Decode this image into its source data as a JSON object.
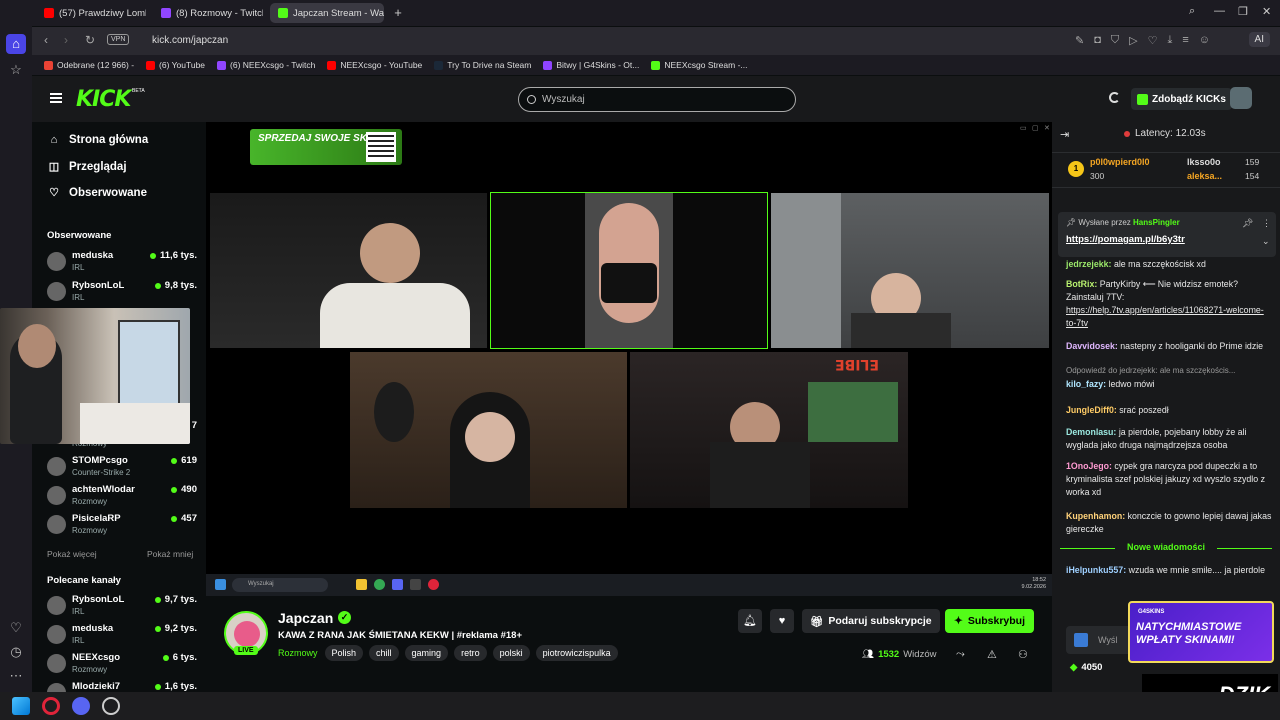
{
  "browser": {
    "tabs": [
      {
        "label": "(57) Prawdziwy Lombard -",
        "color": "#ff0000"
      },
      {
        "label": "(8) Rozmowy - Twitch",
        "color": "#9146ff"
      },
      {
        "label": "Japczan Stream - Watc",
        "color": "#53fc18"
      }
    ],
    "url": "kick.com/japczan",
    "vpn": "VPN",
    "ai_label": "AI",
    "bookmarks": [
      {
        "label": "Odebrane (12 966) -",
        "color": "#ea4335"
      },
      {
        "label": "(6) YouTube",
        "color": "#ff0000"
      },
      {
        "label": "(6) NEEXcsgo - Twitch",
        "color": "#9146ff"
      },
      {
        "label": "NEEXcsgo - YouTube",
        "color": "#ff0000"
      },
      {
        "label": "Try To Drive na Steam",
        "color": "#1b2838"
      },
      {
        "label": "Bitwy | G4Skins - Ot...",
        "color": "#8e44ff"
      },
      {
        "label": "NEEXcsgo Stream -...",
        "color": "#53fc18"
      }
    ]
  },
  "kick": {
    "logo": "KICK",
    "beta": "BETA",
    "search_placeholder": "Wyszukaj",
    "kicks_button": "Zdobądź KICKs",
    "nav": [
      {
        "label": "Strona główna",
        "icon": "home-icon"
      },
      {
        "label": "Przeglądaj",
        "icon": "browse-icon"
      },
      {
        "label": "Obserwowane",
        "icon": "heart-icon"
      }
    ],
    "followed_title": "Obserwowane",
    "followed": [
      {
        "name": "meduska",
        "category": "IRL",
        "viewers": "11,6 tys."
      },
      {
        "name": "RybsonLoL",
        "category": "IRL",
        "viewers": "9,8 tys."
      },
      {
        "name": "STOMPcsgo",
        "category": "Counter-Strike 2",
        "viewers": "619"
      },
      {
        "name": "achtenWlodar",
        "category": "Rozmowy",
        "viewers": "490"
      },
      {
        "name": "PisicelaRP",
        "category": "Rozmowy",
        "viewers": "457"
      }
    ],
    "partial_viewers": "7",
    "partial_category": "Rozmowy",
    "show_more": "Pokaż więcej",
    "show_less": "Pokaż mniej",
    "recommended_title": "Polecane kanały",
    "recommended": [
      {
        "name": "RybsonLoL",
        "category": "IRL",
        "viewers": "9,7 tys."
      },
      {
        "name": "meduska",
        "category": "IRL",
        "viewers": "9,2 tys."
      },
      {
        "name": "NEEXcsgo",
        "category": "Rozmowy",
        "viewers": "6 tys."
      },
      {
        "name": "Mlodzieki7",
        "category": "",
        "viewers": "1,6 tys."
      }
    ]
  },
  "player": {
    "promo_text": "SPRZEDAJ SWOJE SKINY",
    "taskbar_search": "Wyszukaj",
    "taskbar_time": "18:52",
    "taskbar_date": "9.02.2026",
    "sign_text": "ELIBE"
  },
  "stream": {
    "name": "Japczan",
    "title": "KAWA Z RANA JAK ŚMIETANA KEKW | #reklama #18+",
    "live": "LIVE",
    "category": "Rozmowy",
    "tags": [
      "Polish",
      "chill",
      "gaming",
      "retro",
      "polski",
      "piotrowiczispulka"
    ],
    "gift_button": "Podaruj subskrypcje",
    "subscribe_button": "Subskrybuj",
    "viewers": "1532",
    "viewers_label": "Widzów"
  },
  "chat": {
    "latency": "Latency: 12.03s",
    "leaderboard": [
      {
        "rank": "1",
        "name": "p0l0wpierd0l0",
        "value": "300",
        "color": "#f5a623"
      },
      {
        "name": "lksso0o",
        "value": "159",
        "color": "#dddddd"
      },
      {
        "name": "aleksa...",
        "value": "154",
        "color": "#f5a623"
      }
    ],
    "pinned_by_label": "Wysłane przez",
    "pinned_by": "HansPingler",
    "pinned_link": "https://pomagam.pl/b6y3tr",
    "messages": [
      {
        "user": "jedrzejekk:",
        "text": "ale ma szczękościsk xd",
        "color": "#9be86a"
      },
      {
        "user": "BotRix:",
        "text": "PartyKirby ⟵ Nie widzisz emotek? Zainstaluj 7TV:",
        "link": "https://help.7tv.app/en/articles/11068271-welcome-to-7tv",
        "color": "#b8f06f"
      },
      {
        "user": "Davvidosek:",
        "text": "nastepny z hooliganki do Prime idzie",
        "color": "#e0b7ff"
      },
      {
        "reply": "Odpowiedź do jedrzejekk: ale ma szczękościs...",
        "user": "kilo_fazy:",
        "text": "ledwo mówi",
        "color": "#b0e6ff"
      },
      {
        "user": "JungleDiff0:",
        "text": "srać poszedł",
        "color": "#ffcc66"
      },
      {
        "user": "Demonlasu:",
        "text": "ja pierdole, pojebany lobby że ali wyglada jako druga najmądrzejsza osoba",
        "color": "#9be8e0"
      },
      {
        "user": "1OnoJego:",
        "text": "cypek gra narcyza pod dupeczki a to kryminalista szef polskiej jakuzy xd wyszlo szydlo z worka xd",
        "color": "#ff9bd2"
      },
      {
        "user": "Kupenhamon:",
        "text": "konczcie to gowno lepiej dawaj jakas giereczke",
        "color": "#ffd27a"
      },
      {
        "user": "iHelpunku557:",
        "text": "wzuda we mnie smile.... ja pierdole",
        "color": "#9fd0ff"
      }
    ],
    "new_messages": "Nowe wiadomości",
    "input_placeholder": "Wyśl",
    "points": "4050",
    "ad_top": "G4SKINS",
    "ad_text": "NATYCHMIASTOWE WPŁATY SKINAMI!",
    "overlay_logo": "DZIK"
  }
}
